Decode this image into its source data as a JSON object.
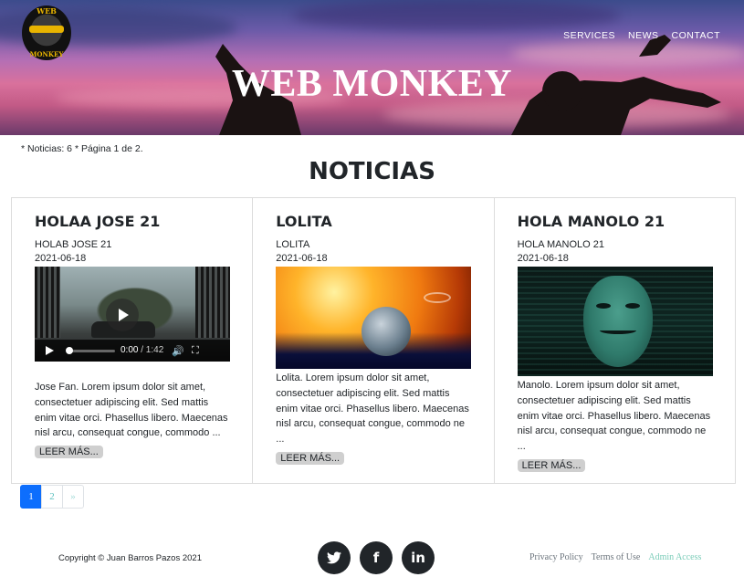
{
  "header": {
    "logo_top_text": "WEB",
    "logo_bottom_text": "MONKEY",
    "brand_title": "WEB MONKEY",
    "nav": [
      {
        "label": "SERVICES"
      },
      {
        "label": "NEWS"
      },
      {
        "label": "CONTACT"
      }
    ]
  },
  "meta": {
    "info": "* Noticias: 6 * Página 1 de 2."
  },
  "section_title": "NOTICIAS",
  "cards": [
    {
      "title": "HOLAA JOSE 21",
      "subtitle": "HOLAB JOSE 21",
      "date": "2021-06-18",
      "media_type": "video",
      "video_current": "0:00",
      "video_duration": "/ 1:42",
      "text": "Jose Fan. Lorem ipsum dolor sit amet, consectetuer adipiscing elit. Sed mattis enim vitae orci. Phasellus libero. Maecenas nisl arcu, consequat congue, commodo ...",
      "read_more": "LEER MÁS..."
    },
    {
      "title": "LOLITA",
      "subtitle": "LOLITA",
      "date": "2021-06-18",
      "media_type": "image",
      "text": "Lolita. Lorem ipsum dolor sit amet, consectetuer adipiscing elit. Sed mattis enim vitae orci. Phasellus libero. Maecenas nisl arcu, consequat congue, commodo ne ...",
      "read_more": "LEER MÁS..."
    },
    {
      "title": "HOLA MANOLO 21",
      "subtitle": "HOLA MANOLO 21",
      "date": "2021-06-18",
      "media_type": "image",
      "text": "Manolo. Lorem ipsum dolor sit amet, consectetuer adipiscing elit. Sed mattis enim vitae orci. Phasellus libero. Maecenas nisl arcu, consequat congue, commodo ne ...",
      "read_more": "LEER MÁS..."
    }
  ],
  "pagination": {
    "pages": [
      "1",
      "2"
    ],
    "next": "»",
    "current": "1"
  },
  "footer": {
    "copyright": "Copyright © Juan Barros Pazos 2021",
    "socials": [
      {
        "icon": "twitter-icon",
        "glyph": "🐦"
      },
      {
        "icon": "facebook-icon",
        "glyph": "f"
      },
      {
        "icon": "linkedin-icon",
        "glyph": "in"
      }
    ],
    "links": [
      {
        "label": "Privacy Policy"
      },
      {
        "label": "Terms of Use"
      },
      {
        "label": "Admin Access"
      }
    ]
  },
  "colors": {
    "pagination_active": "#0d6efd",
    "link_accent": "#7ccdb9",
    "dark": "#212529"
  }
}
